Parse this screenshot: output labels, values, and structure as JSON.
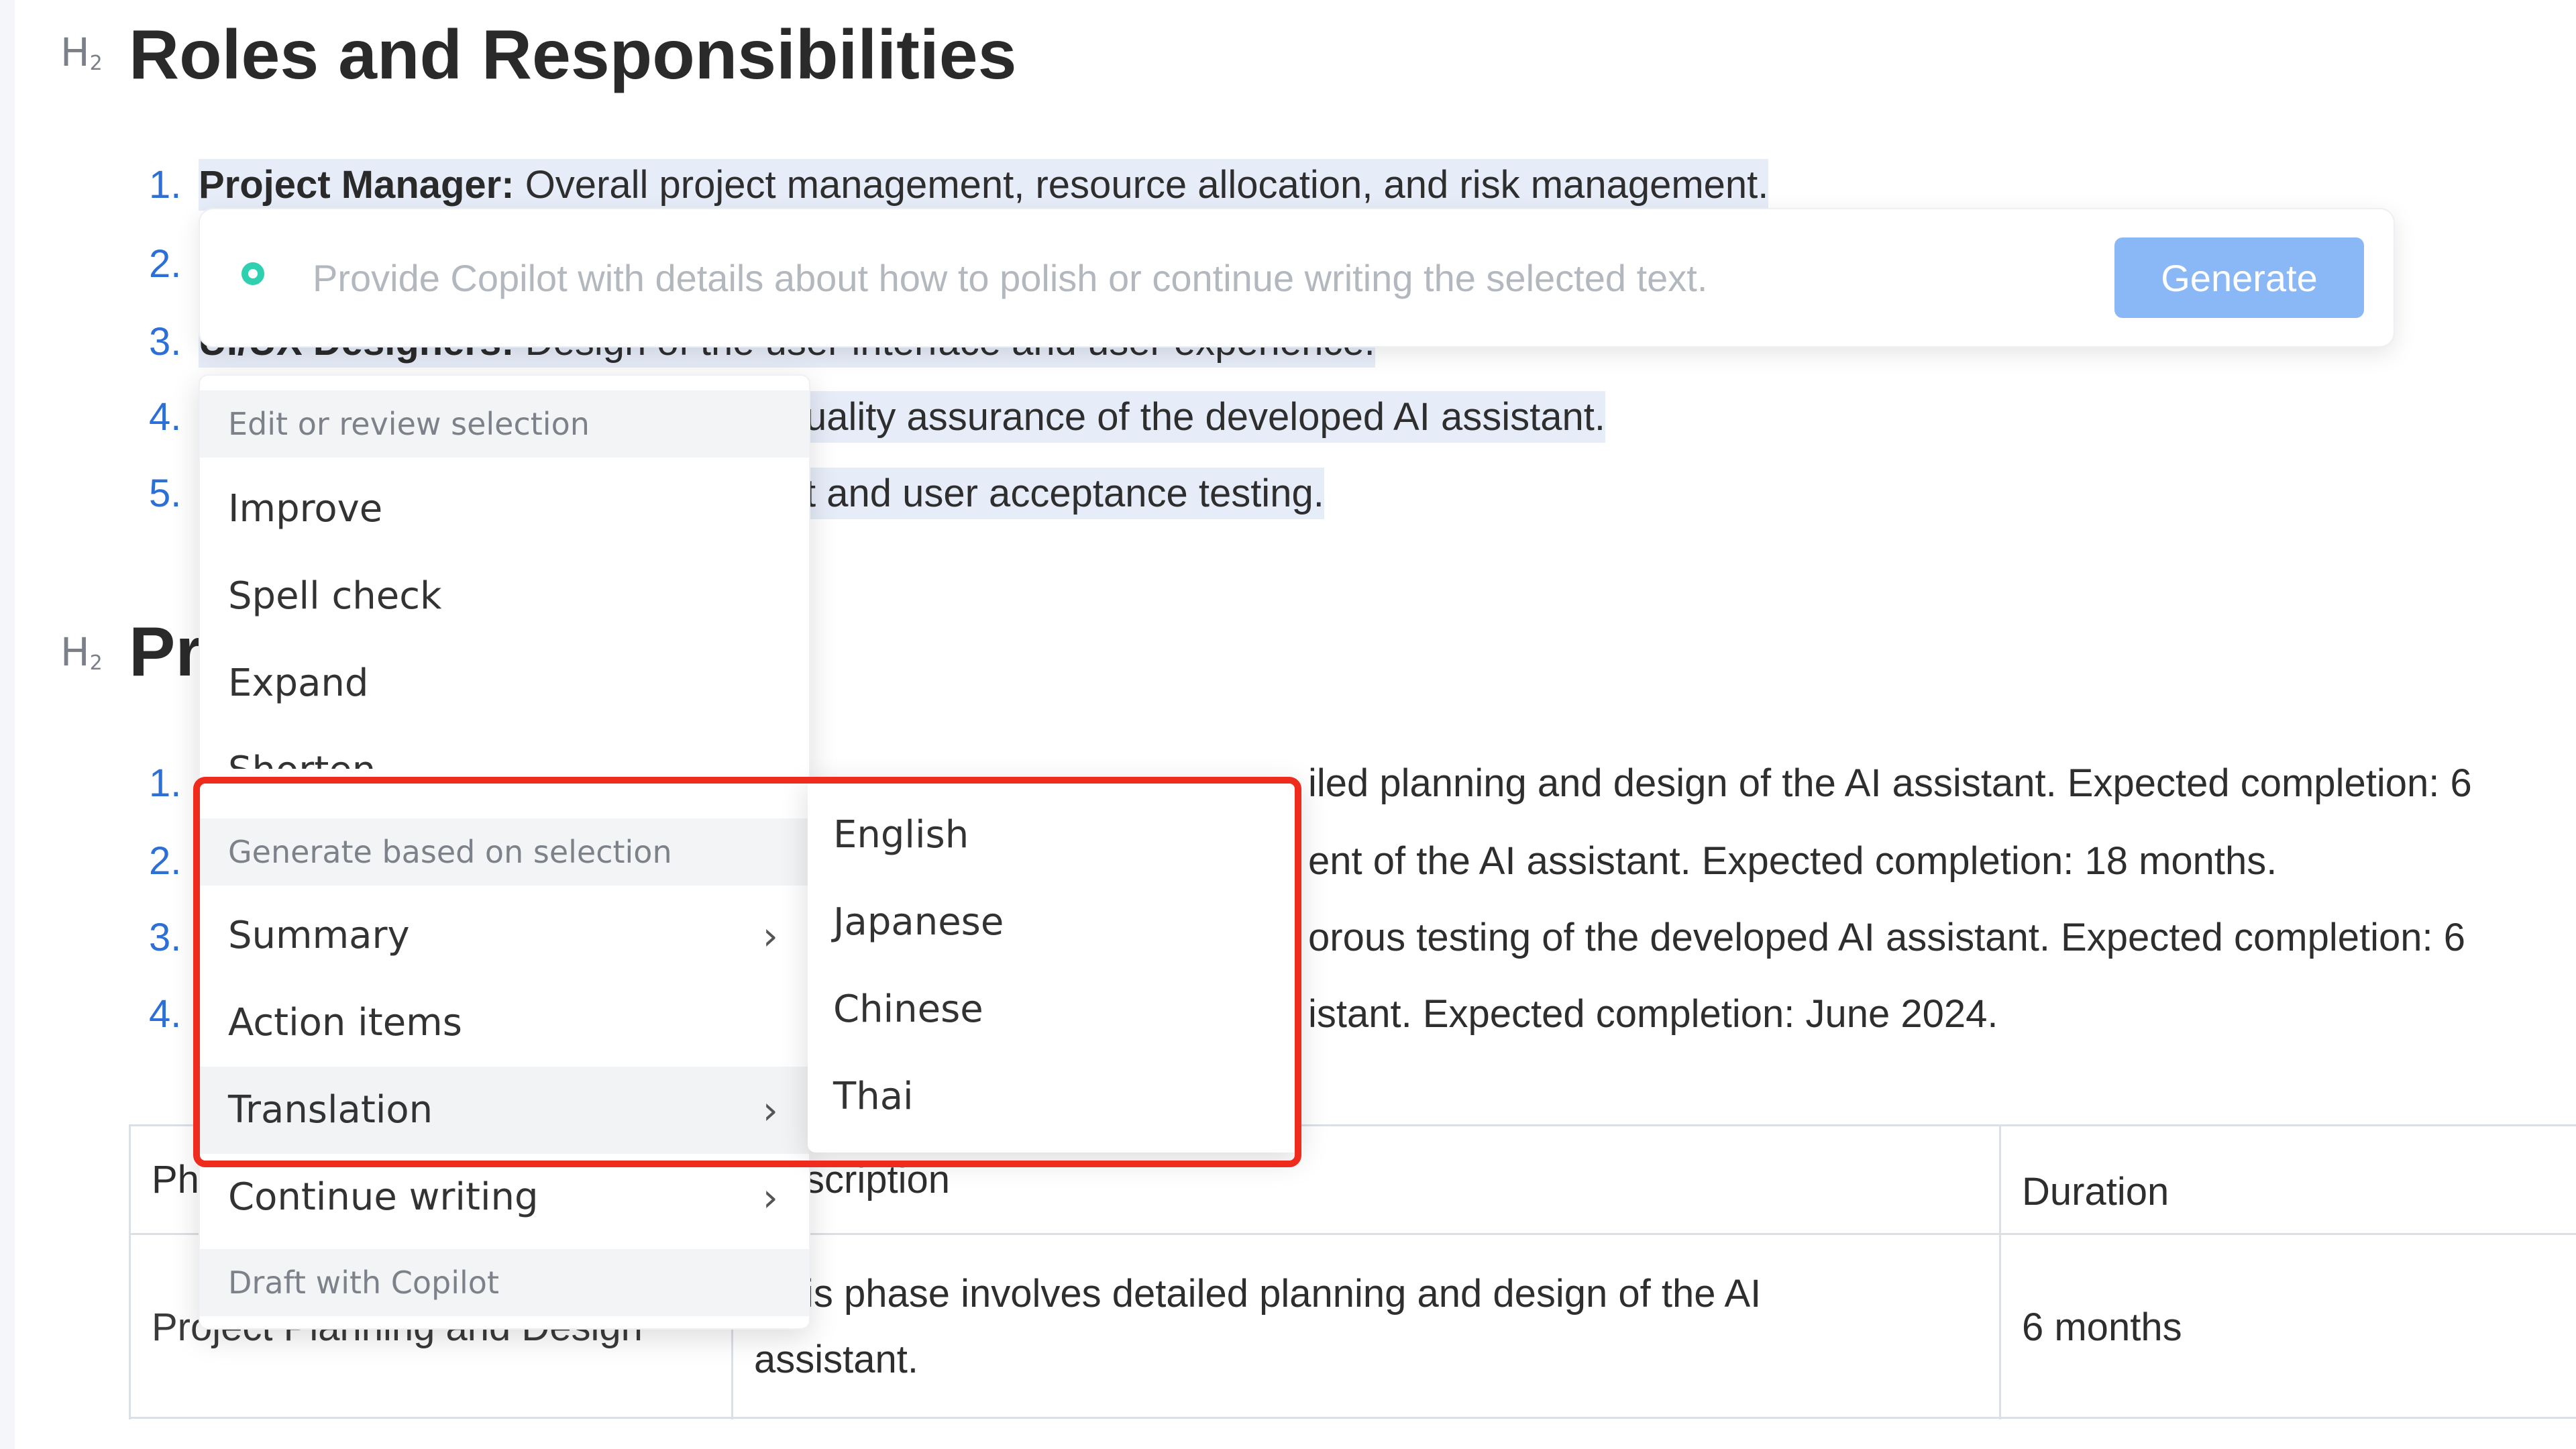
{
  "document": {
    "heading_marker": "H",
    "heading_marker_sub": "2",
    "section1_title": "Roles and Responsibilities",
    "section1_items": [
      {
        "num": "1.",
        "bold": "Project Manager:",
        "text": " Overall project management, resource allocation, and risk management."
      },
      {
        "num": "2.",
        "bold": "",
        "text": ""
      },
      {
        "num": "3.",
        "bold": "UI/UX Designers:",
        "text": " Design of the user interface and user experience."
      },
      {
        "num": "4.",
        "bold": "",
        "text": "uality assurance of the developed AI assistant."
      },
      {
        "num": "5.",
        "bold": "",
        "text": "t and user acceptance testing."
      }
    ],
    "section2_title": "Pr",
    "section2_items": [
      {
        "num": "1.",
        "text": "iled planning and design of the AI assistant. Expected completion: 6"
      },
      {
        "num": "2.",
        "text": "ent of the AI assistant. Expected completion: 18 months."
      },
      {
        "num": "3.",
        "text": "orous testing of the developed AI assistant. Expected completion: 6"
      },
      {
        "num": "4.",
        "text": "istant. Expected completion: June 2024."
      }
    ],
    "table": {
      "headers": [
        "Ph",
        "scription",
        "Duration"
      ],
      "rows": [
        [
          "Project Planning and Design",
          "is phase involves detailed planning and design of the AI",
          "assistant.",
          "6 months"
        ]
      ]
    }
  },
  "copilot_prompt": {
    "placeholder": "Provide Copilot with details about how to polish or continue writing the selected text.",
    "generate_label": "Generate"
  },
  "context_menu": {
    "header_edit": "Edit or review selection",
    "items_edit": [
      "Improve",
      "Spell check",
      "Expand",
      "Shorten"
    ],
    "header_generate": "Generate based on selection",
    "items_generate": [
      "Summary",
      "Action items",
      "Translation",
      "Continue writing"
    ],
    "header_draft": "Draft with Copilot",
    "chevron": "›"
  },
  "translation_submenu": {
    "items": [
      "English",
      "Japanese",
      "Chinese",
      "Thai"
    ]
  },
  "colors": {
    "accent_blue": "#2c6fd6",
    "generate_button": "#8ab8f6",
    "selection_highlight": "#e6ecf8",
    "copilot_ring": "#2fd0b0",
    "annotation_red": "#ee2b1c"
  }
}
